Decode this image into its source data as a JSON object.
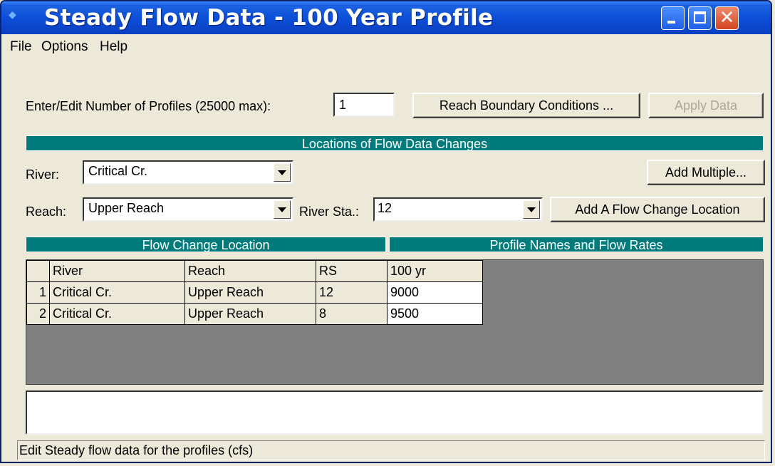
{
  "window": {
    "title": "Steady Flow Data - 100 Year Profile"
  },
  "menu": {
    "file": "File",
    "options": "Options",
    "help": "Help"
  },
  "profiles": {
    "label": "Enter/Edit Number of Profiles (25000 max):",
    "value": "1",
    "reach_bc_button": "Reach Boundary Conditions ...",
    "apply_button": "Apply Data"
  },
  "locations": {
    "header": "Locations of Flow Data Changes",
    "river_label": "River:",
    "river_value": "Critical Cr.",
    "reach_label": "Reach:",
    "reach_value": "Upper Reach",
    "river_sta_label": "River Sta.:",
    "river_sta_value": "12",
    "add_multiple_button": "Add Multiple...",
    "add_flow_change_button": "Add A Flow Change Location"
  },
  "table": {
    "left_header": "Flow Change Location",
    "right_header": "Profile Names and Flow Rates",
    "columns": {
      "river": "River",
      "reach": "Reach",
      "rs": "RS",
      "profile": "100 yr"
    },
    "rows": [
      {
        "num": "1",
        "river": "Critical Cr.",
        "reach": "Upper Reach",
        "rs": "12",
        "flow": "9000"
      },
      {
        "num": "2",
        "river": "Critical Cr.",
        "reach": "Upper Reach",
        "rs": "8",
        "flow": "9500"
      }
    ]
  },
  "status": {
    "text": "Edit Steady flow data for the profiles (cfs)"
  }
}
